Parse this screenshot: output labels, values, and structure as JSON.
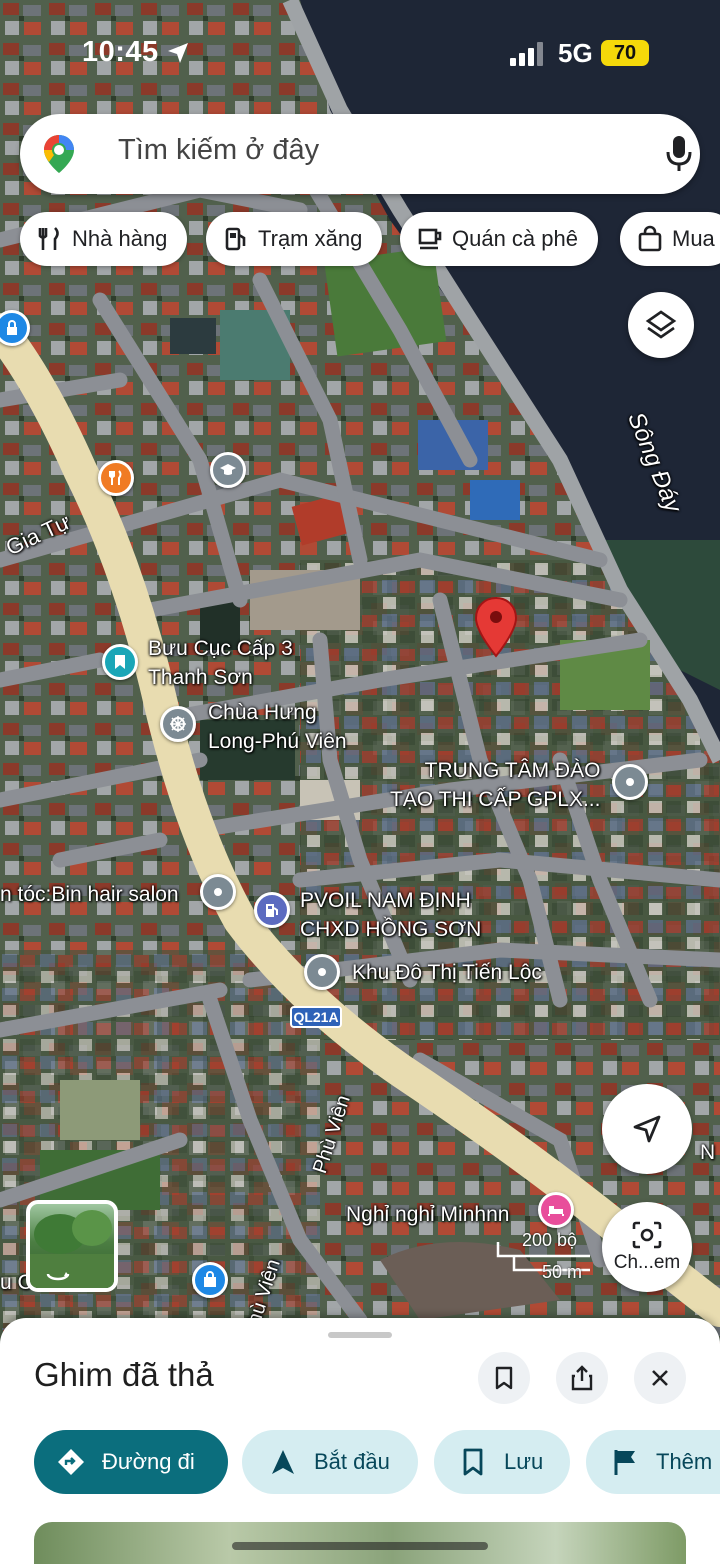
{
  "status_bar": {
    "time": "10:45",
    "network": "5G",
    "battery": "70"
  },
  "search": {
    "placeholder": "Tìm kiếm ở đây"
  },
  "chips": [
    {
      "label": "Nhà hàng",
      "icon": "fork-knife-icon"
    },
    {
      "label": "Trạm xăng",
      "icon": "gas-station-icon"
    },
    {
      "label": "Quán cà phê",
      "icon": "coffee-cup-icon"
    },
    {
      "label": "Mua",
      "icon": "shopping-bag-icon"
    }
  ],
  "map": {
    "river_label": "Sông Đáy",
    "places": {
      "buu_cuc": "Bưu Cục Cấp 3\nThanh Sơn",
      "chua": "Chùa Hưng\nLong-Phú Viên",
      "trung_tam": "TRUNG TÂM ĐÀO\nTẠO THI CẤP GPLX...",
      "salon": "n tóc:Bin hair salon",
      "pvoil": "PVOIL NAM ĐỊNH\nCHXD HỒNG SƠN",
      "khu_do_thi": "Khu Đô Thị Tiến Lộc",
      "nghi": "Nghỉ nghỉ Minhnn",
      "thom": "u C    Thơm",
      "right_edge": "N"
    },
    "roads": {
      "gia_tu": "Gia Tự",
      "ql21a": "QL21A",
      "phu_vien_1": "Phù Viên",
      "phu_vien_2": "Phù Viên"
    },
    "scale": {
      "imperial": "200 bộ",
      "metric": "50 m"
    },
    "lens_label": "Ch...em",
    "colors": {
      "pin_red": "#e53935",
      "pin_teal": "#1aa6b7",
      "road_main": "#e8dcb0",
      "road_minor": "#8c8f95"
    }
  },
  "sheet": {
    "title": "Ghim đã thả",
    "actions": [
      {
        "label": "Đường đi",
        "icon": "directions-icon",
        "style": "primary"
      },
      {
        "label": "Bắt đầu",
        "icon": "navigation-arrow-icon",
        "style": "secondary"
      },
      {
        "label": "Lưu",
        "icon": "bookmark-icon",
        "style": "secondary"
      },
      {
        "label": "Thêm",
        "icon": "flag-icon",
        "style": "secondary"
      }
    ],
    "accent": "#0b6e7d"
  }
}
